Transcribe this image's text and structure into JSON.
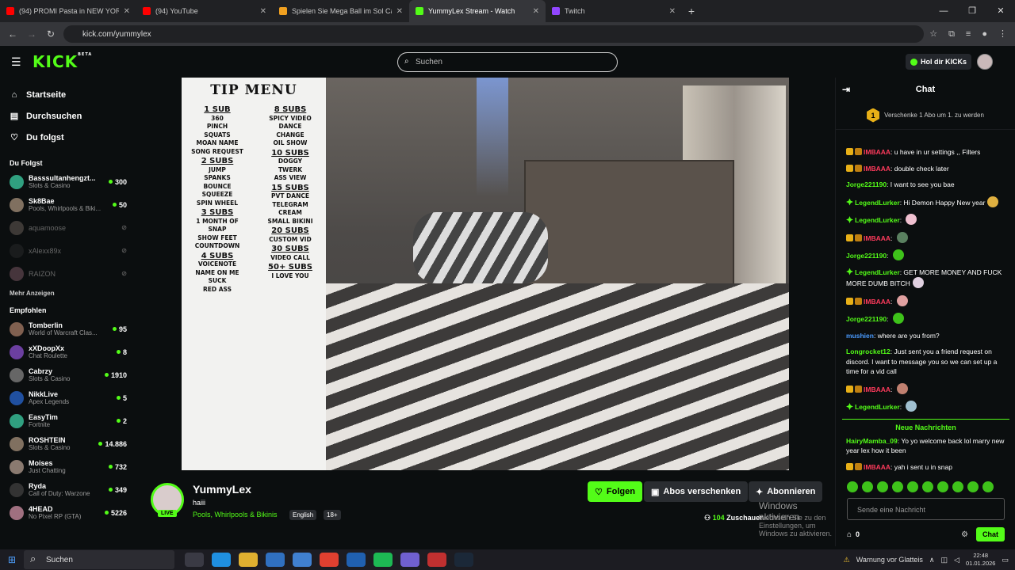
{
  "browser": {
    "tabs": [
      {
        "label": "(94) PROMI Pasta in NEW YORK",
        "icon": "youtube-icon",
        "color": "#ff0000"
      },
      {
        "label": "(94) YouTube",
        "icon": "youtube-icon",
        "color": "#ff0000"
      },
      {
        "label": "Spielen Sie Mega Ball im Sol Ca",
        "icon": "casino-icon",
        "color": "#f0a020"
      },
      {
        "label": "YummyLex Stream - Watch",
        "icon": "kick-icon",
        "color": "#53fc18",
        "active": true
      },
      {
        "label": "Twitch",
        "icon": "twitch-icon",
        "color": "#9146ff"
      }
    ],
    "url": "kick.com/yummylex"
  },
  "kick": {
    "logo": "KICK",
    "logo_beta": "BETA",
    "search_placeholder": "Suchen",
    "get_kicks": "Hol dir KICKs"
  },
  "sidebar": {
    "nav": [
      {
        "label": "Startseite",
        "icon": "home-icon"
      },
      {
        "label": "Durchsuchen",
        "icon": "browse-icon"
      },
      {
        "label": "Du folgst",
        "icon": "heart-icon"
      }
    ],
    "following_title": "Du Folgst",
    "following": [
      {
        "name": "Basssultanhengzt...",
        "category": "Slots & Casino",
        "viewers": "300"
      },
      {
        "name": "Sk8Bae",
        "category": "Pools, Whirlpools & Biki...",
        "viewers": "50"
      },
      {
        "name": "aquamoose",
        "category": "",
        "viewers": "",
        "offline": true
      },
      {
        "name": "xAlexx89x",
        "category": "",
        "viewers": "",
        "offline": true
      },
      {
        "name": "RAIZON",
        "category": "",
        "viewers": "",
        "offline": true
      }
    ],
    "show_more": "Mehr Anzeigen",
    "recommended_title": "Empfohlen",
    "recommended": [
      {
        "name": "Tomberlin",
        "category": "World of Warcraft Clas...",
        "viewers": "95"
      },
      {
        "name": "xXDoopXx",
        "category": "Chat Roulette",
        "viewers": "8"
      },
      {
        "name": "Cabrzy",
        "category": "Slots & Casino",
        "viewers": "1910"
      },
      {
        "name": "NikkLive",
        "category": "Apex Legends",
        "viewers": "5"
      },
      {
        "name": "EasyTim",
        "category": "Fortnite",
        "viewers": "2"
      },
      {
        "name": "ROSHTEIN",
        "category": "Slots & Casino",
        "viewers": "14.886"
      },
      {
        "name": "Moises",
        "category": "Just Chatting",
        "viewers": "732"
      },
      {
        "name": "Ryda",
        "category": "Call of Duty: Warzone",
        "viewers": "349"
      },
      {
        "name": "4HEAD",
        "category": "No Pixel RP (GTA)",
        "viewers": "5226"
      }
    ]
  },
  "tipmenu": {
    "title": "TIP MENU",
    "left": [
      {
        "h": "1 SUB",
        "items": [
          "360",
          "PINCH",
          "SQUATS",
          "MOAN NAME",
          "SONG REQUEST"
        ]
      },
      {
        "h": "2 SUBS",
        "items": [
          "JUMP",
          "SPANKS",
          "BOUNCE",
          "SQUEEZE",
          "SPIN WHEEL"
        ]
      },
      {
        "h": "3 SUBS",
        "items": [
          "1 MONTH OF",
          "SNAP",
          "SHOW FEET",
          "COUNTDOWN"
        ]
      },
      {
        "h": "4 SUBS",
        "items": [
          "VOICENOTE",
          "NAME ON ME",
          "SUCK",
          "RED ASS"
        ]
      }
    ],
    "right": [
      {
        "h": "8 SUBS",
        "items": [
          "SPICY VIDEO",
          "DANCE",
          "CHANGE",
          "OIL SHOW"
        ]
      },
      {
        "h": "10 SUBS",
        "items": [
          "DOGGY",
          "TWERK",
          "ASS VIEW"
        ]
      },
      {
        "h": "15 SUBS",
        "items": [
          "PVT DANCE",
          "TELEGRAM",
          "CREAM",
          "SMALL BIKINI"
        ]
      },
      {
        "h": "20 SUBS",
        "items": [
          "CUSTOM VID"
        ]
      },
      {
        "h": "30 SUBS",
        "items": [
          "VIDEO CALL"
        ]
      },
      {
        "h": "50+ SUBS",
        "items": [
          "I LOVE YOU"
        ]
      }
    ]
  },
  "stream": {
    "live": "LIVE",
    "name": "YummyLex",
    "title": "haiii",
    "category": "Pools, Whirlpools & Bikinis",
    "tags": [
      "English",
      "18+"
    ],
    "follow": "Folgen",
    "gift_subs": "Abos verschenken",
    "subscribe": "Abonnieren",
    "viewers_count": "104",
    "viewers_label": "Zuschauer"
  },
  "windows_activation": {
    "title": "Windows aktivieren",
    "subtitle": "Wechseln Sie zu den Einstellungen, um Windows zu aktivieren."
  },
  "chat": {
    "title": "Chat",
    "pinned_number": "1",
    "pinned_text": "Verschenke 1 Abo um 1. zu werden",
    "messages": [
      {
        "user": "IMBAAA",
        "color": "#ff3b5c",
        "text": "u have in ur settings ,, Filters",
        "badges": 2
      },
      {
        "user": "IMBAAA",
        "color": "#ff3b5c",
        "text": "double check later",
        "badges": 2
      },
      {
        "user": "Jorge221190",
        "color": "#53fc18",
        "text": "I want to see you bae",
        "badges": 0
      },
      {
        "user": "LegendLurker",
        "color": "#53fc18",
        "text": "Hi Demon Happy New year",
        "badges": 1,
        "emote": "#e0b040"
      },
      {
        "user": "LegendLurker",
        "color": "#53fc18",
        "text": "",
        "badges": 1,
        "emote": "#f0c0d0"
      },
      {
        "user": "IMBAAA",
        "color": "#ff3b5c",
        "text": "",
        "badges": 2,
        "emote": "#5a8060"
      },
      {
        "user": "Jorge221190",
        "color": "#53fc18",
        "text": "",
        "badges": 0,
        "emote": "#3ec21a"
      },
      {
        "user": "LegendLurker",
        "color": "#53fc18",
        "text": "GET MORE MONEY AND FUCK MORE DUMB BITCH",
        "badges": 1,
        "emote": "#e0d0e0"
      },
      {
        "user": "IMBAAA",
        "color": "#ff3b5c",
        "text": "",
        "badges": 2,
        "emote": "#e0a0a0"
      },
      {
        "user": "Jorge221190",
        "color": "#53fc18",
        "text": "",
        "badges": 0,
        "emote": "#3ec21a"
      },
      {
        "user": "mushien",
        "color": "#4a9bff",
        "text": "where are you from?",
        "badges": 0
      },
      {
        "user": "Longrocket12",
        "color": "#53fc18",
        "text": "Just sent you a friend request on discord. I want to message you so we can set up a time for a vid call",
        "badges": 0
      },
      {
        "user": "IMBAAA",
        "color": "#ff3b5c",
        "text": "",
        "badges": 2,
        "emote": "#c08070"
      },
      {
        "user": "LegendLurker",
        "color": "#53fc18",
        "text": "",
        "badges": 1,
        "emote": "#a0c0d0"
      }
    ],
    "new_messages_label": "Neue Nachrichten",
    "new_messages": [
      {
        "user": "HairyMamba_09",
        "color": "#53fc18",
        "text": "Yo yo welcome back lol marry new year lex how it been",
        "badges": 0
      },
      {
        "user": "IMBAAA",
        "color": "#ff3b5c",
        "text": "yah i sent u in snap",
        "badges": 2
      }
    ],
    "input_placeholder": "Sende eine Nachricht",
    "points": "0",
    "send_label": "Chat"
  },
  "taskbar": {
    "search": "Suchen",
    "weather": "Warnung vor Glatteis",
    "time": "22:48",
    "date": "01.01.2026"
  }
}
